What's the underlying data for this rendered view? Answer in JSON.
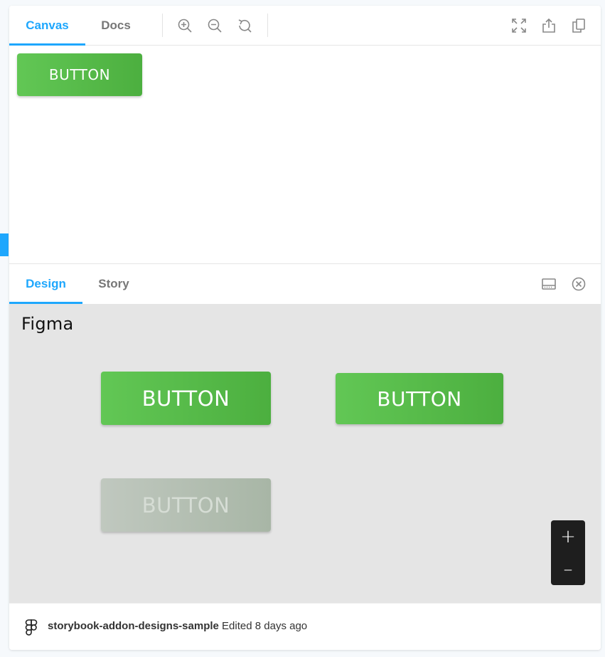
{
  "toolbar": {
    "tabs": [
      {
        "label": "Canvas",
        "active": true
      },
      {
        "label": "Docs",
        "active": false
      }
    ],
    "icons": [
      "zoom-in-icon",
      "zoom-out-icon",
      "reset-zoom-icon",
      "fullscreen-icon",
      "share-icon",
      "copy-link-icon"
    ]
  },
  "canvas": {
    "button_label": "BUTTON"
  },
  "addon_panel": {
    "tabs": [
      {
        "label": "Design",
        "active": true
      },
      {
        "label": "Story",
        "active": false
      }
    ],
    "icons": [
      "panel-layout-icon",
      "close-icon"
    ]
  },
  "design": {
    "wordmark": "Figma",
    "buttons": [
      {
        "label": "BUTTON",
        "state": "default"
      },
      {
        "label": "BUTTON",
        "state": "default"
      },
      {
        "label": "BUTTON",
        "state": "disabled"
      }
    ],
    "zoom": {
      "in_label": "+",
      "out_label": "–"
    }
  },
  "footer": {
    "file_name": "storybook-addon-designs-sample",
    "edited": "Edited 8 days ago"
  },
  "colors": {
    "accent": "#1ea7fd",
    "button_green": "#56bb48",
    "button_disabled": "#aab8a8",
    "design_bg": "#e5e5e5"
  }
}
